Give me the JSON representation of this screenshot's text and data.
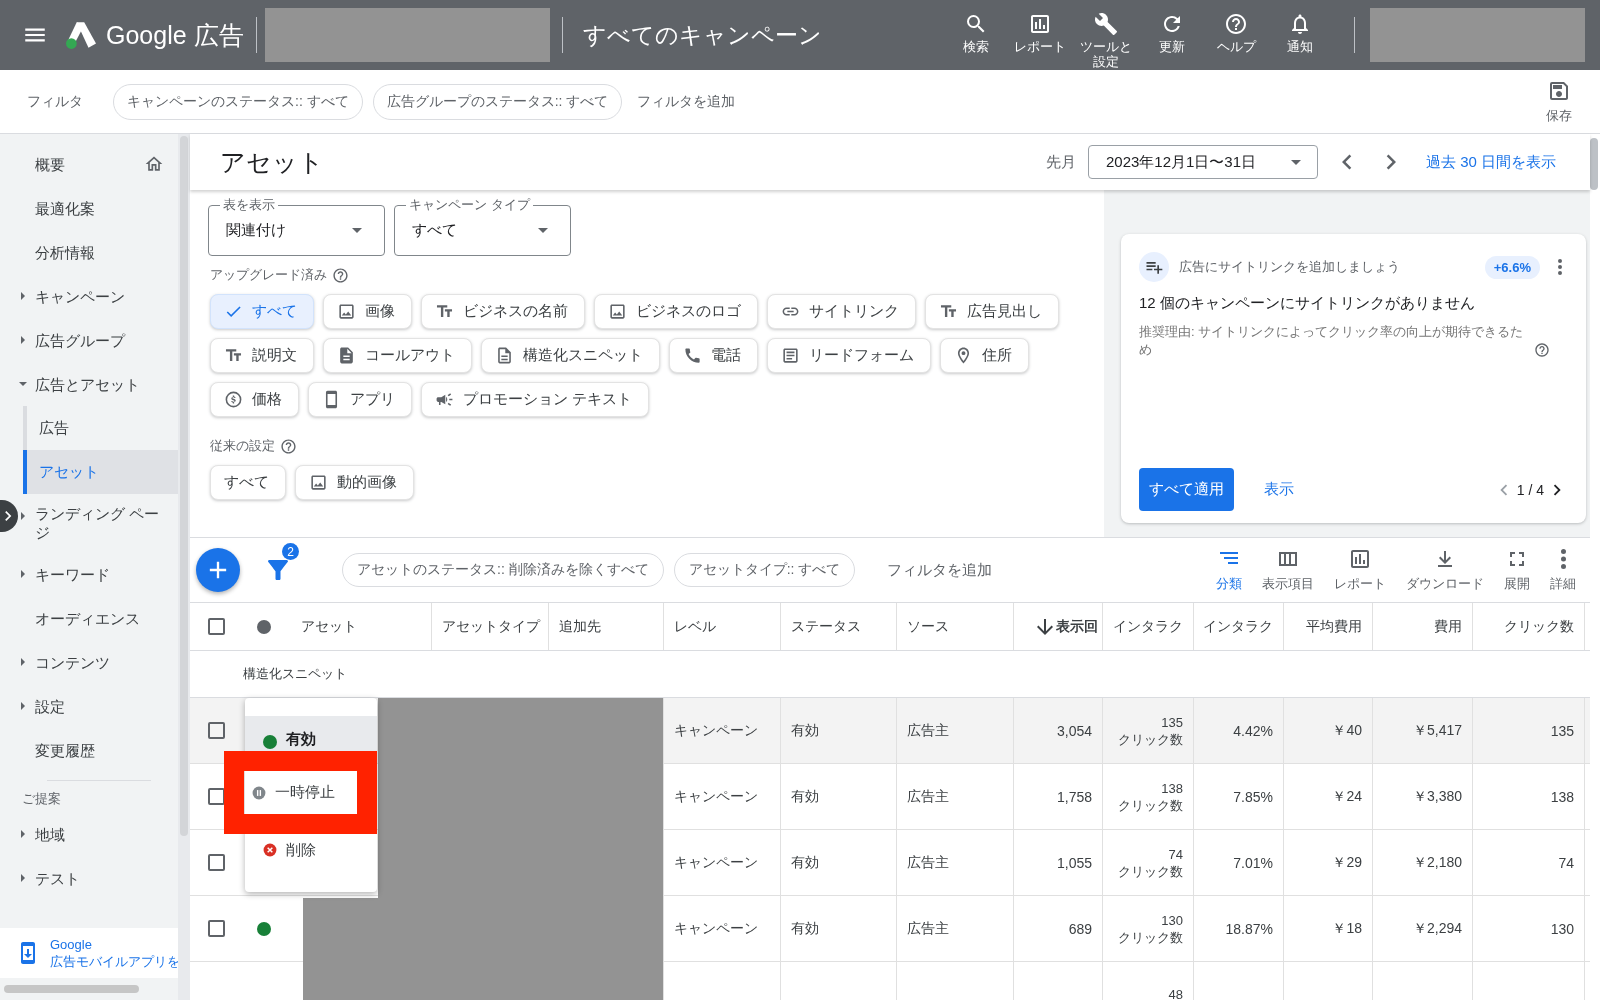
{
  "top_bar": {
    "product": "Google 広告",
    "account_title": "すべてのキャンペーン",
    "actions": [
      {
        "label": "検索",
        "kind": "search"
      },
      {
        "label": "レポート",
        "kind": "report"
      },
      {
        "label": "ツールと設定",
        "kind": "tools"
      },
      {
        "label": "更新",
        "kind": "refresh"
      },
      {
        "label": "ヘルプ",
        "kind": "help"
      },
      {
        "label": "通知",
        "kind": "notifications"
      }
    ]
  },
  "filter_bar": {
    "label": "フィルタ",
    "chips": [
      "キャンペーンのステータス:: すべて",
      "広告グループのステータス:: すべて"
    ],
    "add_filter": "フィルタを追加",
    "save": "保存"
  },
  "sidebar": {
    "items": [
      {
        "label": "概要",
        "kind": "home",
        "selected": false
      },
      {
        "label": "最適化案",
        "kind": "page",
        "selected": false
      },
      {
        "label": "分析情報",
        "kind": "page",
        "selected": false
      },
      {
        "label": "キャンペーン",
        "kind": "group",
        "expanded": false,
        "selected": false
      },
      {
        "label": "広告グループ",
        "kind": "group",
        "expanded": false,
        "selected": false
      },
      {
        "label": "広告とアセット",
        "kind": "group",
        "expanded": true,
        "selected": false,
        "children": [
          {
            "label": "広告",
            "selected": false
          },
          {
            "label": "アセット",
            "selected": true
          }
        ]
      },
      {
        "label": "ランディング ページ",
        "kind": "group",
        "expanded": false,
        "selected": false
      },
      {
        "label": "キーワード",
        "kind": "group",
        "expanded": false,
        "selected": false
      },
      {
        "label": "オーディエンス",
        "kind": "page",
        "selected": false
      },
      {
        "label": "コンテンツ",
        "kind": "group",
        "expanded": false,
        "selected": false
      },
      {
        "label": "設定",
        "kind": "group",
        "expanded": false,
        "selected": false
      },
      {
        "label": "変更履歴",
        "kind": "page",
        "selected": false
      },
      {
        "label": "ご提案",
        "kind": "heading"
      },
      {
        "label": "地域",
        "kind": "group",
        "expanded": false,
        "selected": false
      },
      {
        "label": "テスト",
        "kind": "group",
        "expanded": false,
        "selected": false
      }
    ],
    "promo": {
      "title": "Google",
      "text": "広告モバイルアプリを"
    }
  },
  "page": {
    "title": "アセット",
    "period_label": "先月",
    "date_range": "2023年12月1日〜31日",
    "recent_link": "過去 30 日間を表示"
  },
  "filters": {
    "dropdowns": [
      {
        "label": "表を表示",
        "value": "関連付け"
      },
      {
        "label": "キャンペーン タイプ",
        "value": "すべて"
      }
    ],
    "upgraded_label": "アップグレード済み",
    "upgraded_chips": [
      {
        "label": "すべて",
        "kind": "all",
        "selected": true
      },
      {
        "label": "画像",
        "kind": "image",
        "selected": false
      },
      {
        "label": "ビジネスの名前",
        "kind": "text",
        "selected": false
      },
      {
        "label": "ビジネスのロゴ",
        "kind": "image",
        "selected": false
      },
      {
        "label": "サイトリンク",
        "kind": "link",
        "selected": false
      },
      {
        "label": "広告見出し",
        "kind": "text",
        "selected": false
      },
      {
        "label": "説明文",
        "kind": "text",
        "selected": false
      },
      {
        "label": "コールアウト",
        "kind": "callout",
        "selected": false
      },
      {
        "label": "構造化スニペット",
        "kind": "snippet",
        "selected": false
      },
      {
        "label": "電話",
        "kind": "phone",
        "selected": false
      },
      {
        "label": "リードフォーム",
        "kind": "form",
        "selected": false
      },
      {
        "label": "住所",
        "kind": "location",
        "selected": false
      },
      {
        "label": "価格",
        "kind": "price",
        "selected": false
      },
      {
        "label": "アプリ",
        "kind": "app",
        "selected": false
      },
      {
        "label": "プロモーション テキスト",
        "kind": "promotion",
        "selected": false
      }
    ],
    "legacy_label": "従来の設定",
    "legacy_chips": [
      {
        "label": "すべて",
        "kind": "all",
        "selected": false
      },
      {
        "label": "動的画像",
        "kind": "image",
        "selected": false
      }
    ]
  },
  "recommendation": {
    "title": "広告にサイトリンクを追加しましょう",
    "uplift": "+6.6%",
    "headline": "12 個のキャンペーンにサイトリンクがありません",
    "reason": "推奨理由: サイトリンクによってクリック率の向上が期待できるため",
    "apply": "すべて適用",
    "view": "表示",
    "pager": "1 / 4"
  },
  "table_toolbar": {
    "filter_count": "2",
    "chips": [
      "アセットのステータス:: 削除済みを除くすべて",
      "アセットタイプ:: すべて"
    ],
    "add_filter": "フィルタを追加",
    "actions": [
      {
        "label": "分類",
        "kind": "segment",
        "selected": true
      },
      {
        "label": "表示項目",
        "kind": "columns",
        "selected": false
      },
      {
        "label": "レポート",
        "kind": "report",
        "selected": false
      },
      {
        "label": "ダウンロード",
        "kind": "download",
        "selected": false
      },
      {
        "label": "展開",
        "kind": "expand",
        "selected": false
      },
      {
        "label": "詳細",
        "kind": "more",
        "selected": false
      }
    ]
  },
  "table": {
    "all_checked": false,
    "columns": [
      {
        "label": "アセット",
        "sorted": false
      },
      {
        "label": "アセットタイプ",
        "sorted": false
      },
      {
        "label": "追加先",
        "sorted": false
      },
      {
        "label": "レベル",
        "sorted": false
      },
      {
        "label": "ステータス",
        "sorted": false
      },
      {
        "label": "ソース",
        "sorted": false
      },
      {
        "label": "表示回",
        "sorted": true
      },
      {
        "label": "インタラク",
        "sorted": false
      },
      {
        "label": "インタラク",
        "sorted": false
      },
      {
        "label": "平均費用",
        "sorted": false
      },
      {
        "label": "費用",
        "sorted": false
      },
      {
        "label": "クリック数",
        "sorted": false
      }
    ],
    "group": "構造化スニペット",
    "rows": [
      {
        "checked": false,
        "highlighted": true,
        "level": "キャンペーン",
        "status": "有効",
        "source": "広告主",
        "impressions": "3,054",
        "interactions": "135",
        "interaction_label": "クリック数",
        "rate": "4.42%",
        "avg_cost": "￥40",
        "cost": "￥5,417",
        "clicks": "135"
      },
      {
        "checked": false,
        "highlighted": false,
        "level": "キャンペーン",
        "status": "有効",
        "source": "広告主",
        "impressions": "1,758",
        "interactions": "138",
        "interaction_label": "クリック数",
        "rate": "7.85%",
        "avg_cost": "￥24",
        "cost": "￥3,380",
        "clicks": "138"
      },
      {
        "checked": false,
        "highlighted": false,
        "level": "キャンペーン",
        "status": "有効",
        "source": "広告主",
        "impressions": "1,055",
        "interactions": "74",
        "interaction_label": "クリック数",
        "rate": "7.01%",
        "avg_cost": "￥29",
        "cost": "￥2,180",
        "clicks": "74"
      },
      {
        "checked": false,
        "highlighted": false,
        "color": "#188038",
        "level": "キャンペーン",
        "status": "有効",
        "source": "広告主",
        "impressions": "689",
        "interactions": "130",
        "interaction_label": "クリック数",
        "rate": "18.87%",
        "avg_cost": "￥18",
        "cost": "￥2,294",
        "clicks": "130"
      },
      {
        "interactions": "48"
      }
    ]
  },
  "status_menu": {
    "items": [
      {
        "label": "有効",
        "kind": "enabled",
        "selected": true,
        "annotated": false
      },
      {
        "label": "一時停止",
        "kind": "paused",
        "selected": false,
        "annotated": true
      },
      {
        "label": "削除",
        "kind": "removed",
        "selected": false,
        "annotated": false
      }
    ]
  }
}
